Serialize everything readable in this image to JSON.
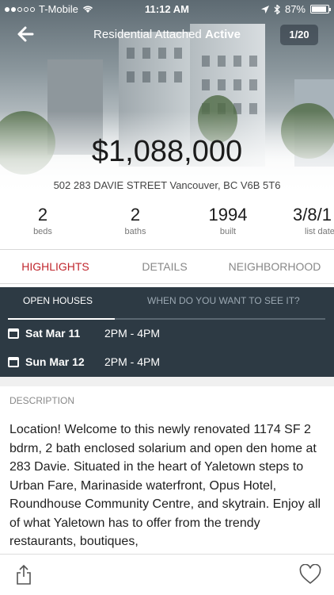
{
  "status_bar": {
    "carrier": "T-Mobile",
    "time": "11:12 AM",
    "battery": "87%"
  },
  "nav": {
    "title_prefix": "Residential Attached",
    "title_status": "Active",
    "pager": "1/20"
  },
  "listing": {
    "price": "$1,088,000",
    "address": "502 283 DAVIE STREET Vancouver, BC V6B 5T6"
  },
  "stats": [
    {
      "value": "2",
      "label": "beds"
    },
    {
      "value": "2",
      "label": "baths"
    },
    {
      "value": "1994",
      "label": "built"
    },
    {
      "value": "3/8/1",
      "label": "list date"
    }
  ],
  "tabs": [
    {
      "label": "HIGHLIGHTS"
    },
    {
      "label": "DETAILS"
    },
    {
      "label": "NEIGHBORHOOD"
    }
  ],
  "open_houses": {
    "tab_open": "OPEN HOUSES",
    "tab_request": "WHEN DO YOU WANT TO SEE IT?",
    "items": [
      {
        "date": "Sat Mar 11",
        "time": "2PM - 4PM"
      },
      {
        "date": "Sun Mar 12",
        "time": "2PM - 4PM"
      }
    ]
  },
  "description": {
    "label": "DESCRIPTION",
    "text": "Location! Welcome to this newly renovated 1174 SF 2 bdrm, 2 bath enclosed solarium and open den home at 283 Davie. Situated in the heart of Yaletown steps to Urban Fare, Marinaside waterfront, Opus Hotel, Roundhouse Community Centre, and skytrain. Enjoy all of what Yaletown has to offer from the trendy restaurants, boutiques,"
  },
  "colors": {
    "accent": "#c0262d",
    "open_house_bg": "#2d3a44"
  },
  "icons": [
    "back-arrow-icon",
    "share-icon",
    "heart-icon",
    "calendar-icon",
    "wifi-icon",
    "location-icon",
    "bluetooth-icon"
  ]
}
